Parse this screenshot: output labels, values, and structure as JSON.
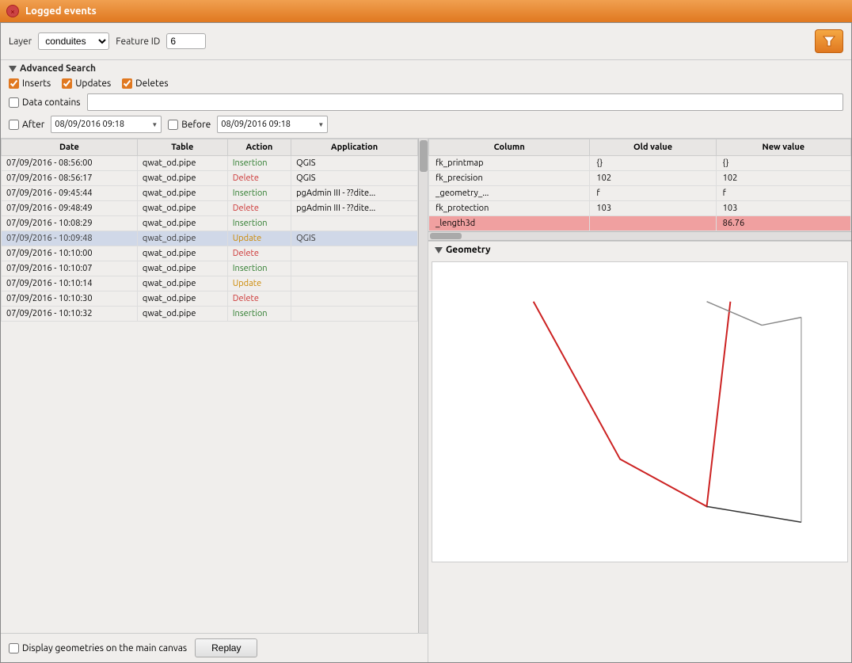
{
  "titleBar": {
    "title": "Logged events",
    "closeLabel": "×"
  },
  "toolbar": {
    "layerLabel": "Layer",
    "layerValue": "conduites",
    "layerOptions": [
      "conduites"
    ],
    "featureIdLabel": "Feature ID",
    "featureIdValue": "6",
    "filterIconLabel": "▼"
  },
  "advancedSearch": {
    "title": "Advanced Search",
    "checkboxes": [
      {
        "label": "Inserts",
        "checked": true
      },
      {
        "label": "Updates",
        "checked": true
      },
      {
        "label": "Deletes",
        "checked": true
      }
    ],
    "dataContainsLabel": "Data contains",
    "dataContainsChecked": false,
    "dataContainsValue": "",
    "afterLabel": "After",
    "afterChecked": false,
    "afterDate": "08/09/2016 09:18",
    "beforeLabel": "Before",
    "beforeChecked": false,
    "beforeDate": "08/09/2016 09:18"
  },
  "eventsTable": {
    "columns": [
      "Date",
      "Table",
      "Action",
      "Application"
    ],
    "rows": [
      {
        "date": "07/09/2016 - 08:56:00",
        "table": "qwat_od.pipe",
        "action": "Insertion",
        "application": "QGIS",
        "actionType": "insertion",
        "highlighted": false
      },
      {
        "date": "07/09/2016 - 08:56:17",
        "table": "qwat_od.pipe",
        "action": "Delete",
        "application": "QGIS",
        "actionType": "delete",
        "highlighted": false
      },
      {
        "date": "07/09/2016 - 09:45:44",
        "table": "qwat_od.pipe",
        "action": "Insertion",
        "application": "pgAdmin III - ??dite...",
        "actionType": "insertion",
        "highlighted": false
      },
      {
        "date": "07/09/2016 - 09:48:49",
        "table": "qwat_od.pipe",
        "action": "Delete",
        "application": "pgAdmin III - ??dite...",
        "actionType": "delete",
        "highlighted": false
      },
      {
        "date": "07/09/2016 - 10:08:29",
        "table": "qwat_od.pipe",
        "action": "Insertion",
        "application": "",
        "actionType": "insertion",
        "highlighted": false
      },
      {
        "date": "07/09/2016 - 10:09:48",
        "table": "qwat_od.pipe",
        "action": "Update",
        "application": "QGIS",
        "actionType": "update",
        "highlighted": true
      },
      {
        "date": "07/09/2016 - 10:10:00",
        "table": "qwat_od.pipe",
        "action": "Delete",
        "application": "",
        "actionType": "delete",
        "highlighted": false
      },
      {
        "date": "07/09/2016 - 10:10:07",
        "table": "qwat_od.pipe",
        "action": "Insertion",
        "application": "",
        "actionType": "insertion",
        "highlighted": false
      },
      {
        "date": "07/09/2016 - 10:10:14",
        "table": "qwat_od.pipe",
        "action": "Update",
        "application": "",
        "actionType": "update",
        "highlighted": false
      },
      {
        "date": "07/09/2016 - 10:10:30",
        "table": "qwat_od.pipe",
        "action": "Delete",
        "application": "",
        "actionType": "delete",
        "highlighted": false
      },
      {
        "date": "07/09/2016 - 10:10:32",
        "table": "qwat_od.pipe",
        "action": "Insertion",
        "application": "",
        "actionType": "insertion",
        "highlighted": false
      }
    ]
  },
  "detailsTable": {
    "columns": [
      "Column",
      "Old value",
      "New value"
    ],
    "rows": [
      {
        "column": "fk_printmap",
        "oldValue": "{}",
        "newValue": "{}",
        "highlighted": false
      },
      {
        "column": "fk_precision",
        "oldValue": "102",
        "newValue": "102",
        "highlighted": false
      },
      {
        "column": "_geometry_...",
        "oldValue": "f",
        "newValue": "f",
        "highlighted": false
      },
      {
        "column": "fk_protection",
        "oldValue": "103",
        "newValue": "103",
        "highlighted": false
      },
      {
        "column": "_length3d",
        "oldValue": "",
        "newValue": "86.76",
        "highlighted": true
      }
    ]
  },
  "geometrySection": {
    "title": "Geometry"
  },
  "bottomBar": {
    "displayGeometriesLabel": "Display geometries on the main canvas",
    "replayLabel": "Replay"
  }
}
